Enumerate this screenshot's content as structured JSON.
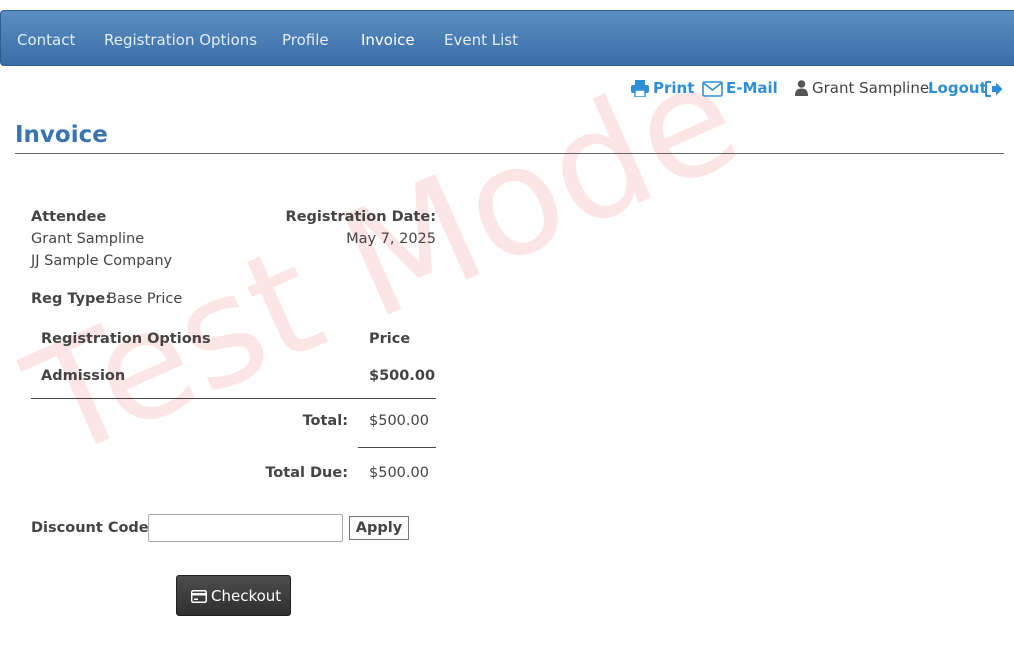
{
  "nav": {
    "items": [
      {
        "label": "Contact"
      },
      {
        "label": "Registration Options"
      },
      {
        "label": "Profile"
      },
      {
        "label": "Invoice"
      },
      {
        "label": "Event List"
      }
    ],
    "active": "Invoice"
  },
  "toolbar": {
    "print_label": "Print",
    "email_label": "E-Mail",
    "user_name": "Grant Sampline",
    "logout_label": "Logout"
  },
  "page": {
    "title": "Invoice",
    "watermark": "Test Mode"
  },
  "attendee": {
    "heading": "Attendee",
    "name": "Grant Sampline",
    "company": "JJ Sample Company"
  },
  "registration_date": {
    "label": "Registration Date:",
    "value": "May 7, 2025"
  },
  "reg_type": {
    "label": "Reg Type:",
    "value": "Base Price"
  },
  "options_table": {
    "headers": {
      "option": "Registration Options",
      "price": "Price"
    },
    "rows": [
      {
        "option": "Admission",
        "price": "$500.00"
      }
    ]
  },
  "totals": {
    "total_label": "Total:",
    "total_value": "$500.00",
    "due_label": "Total Due:",
    "due_value": "$500.00"
  },
  "discount": {
    "label": "Discount Code:",
    "value": "",
    "placeholder": "",
    "apply_label": "Apply"
  },
  "checkout": {
    "label": "Checkout"
  },
  "colors": {
    "nav_bg": "#4a7fb5",
    "link": "#2f8fd6",
    "title": "#3a74ae",
    "watermark": "#f4c4c4",
    "checkout_bg": "#3a3a3a"
  }
}
